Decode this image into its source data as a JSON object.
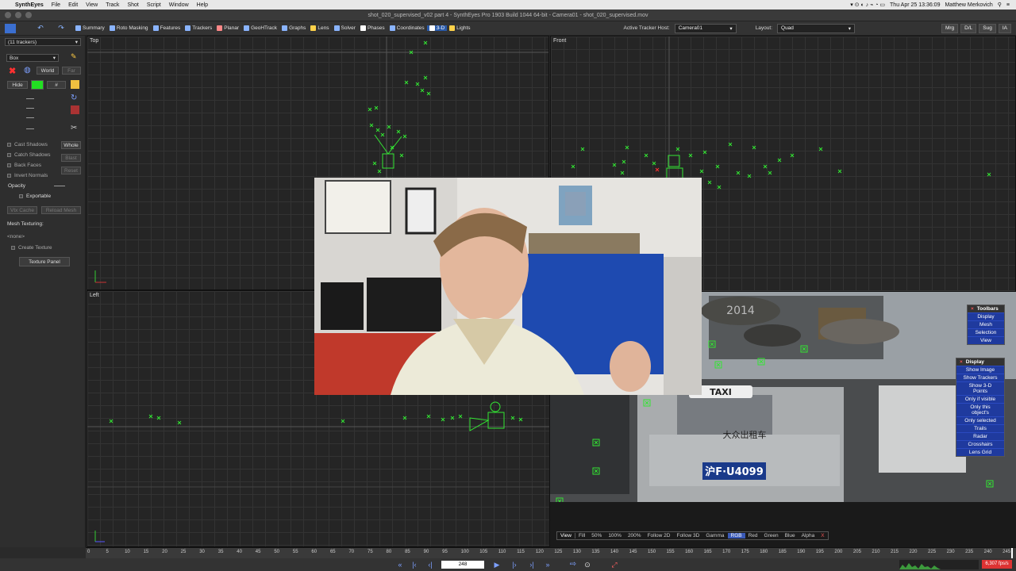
{
  "menubar": {
    "items": [
      "SynthEyes",
      "File",
      "Edit",
      "View",
      "Track",
      "Shot",
      "Script",
      "Window",
      "Help"
    ],
    "datetime": "Thu Apr 25  13:36:09",
    "user": "Matthew Merkovich"
  },
  "window": {
    "title": "shot_020_supervised_v02 part 4 - SynthEyes Pro 1903 Build 1044 64-bit - Camera01 - shot_020_supervised.mov"
  },
  "toolbar": {
    "tabs": [
      {
        "label": "Summary",
        "icon": "sigma-icon",
        "color": "#8ab4ff"
      },
      {
        "label": "Roto Masking",
        "icon": "roto-icon",
        "color": "#8ab4ff"
      },
      {
        "label": "Features",
        "icon": "features-icon",
        "color": "#8ab4ff"
      },
      {
        "label": "Trackers",
        "icon": "trackers-icon",
        "color": "#8ab4ff"
      },
      {
        "label": "Planar",
        "icon": "planar-icon",
        "color": "#ff8888"
      },
      {
        "label": "GeoHTrack",
        "icon": "geohtrack-icon",
        "color": "#8ab4ff"
      },
      {
        "label": "Graphs",
        "icon": "graphs-icon",
        "color": "#8ab4ff"
      },
      {
        "label": "Lens",
        "icon": "lens-icon",
        "color": "#ffd24a"
      },
      {
        "label": "Solver",
        "icon": "solver-icon",
        "color": "#8ab4ff"
      },
      {
        "label": "Phases",
        "icon": "phases-icon",
        "color": "#ffffff"
      },
      {
        "label": "Coordinates",
        "icon": "coordinates-icon",
        "color": "#8ab4ff"
      },
      {
        "label": "3-D",
        "icon": "cube-icon",
        "color": "#ffffff"
      },
      {
        "label": "Lights",
        "icon": "bulb-icon",
        "color": "#ffd24a"
      }
    ],
    "active_tab": "3-D",
    "active_tracker_host_label": "Active Tracker Host:",
    "active_tracker_host_value": "Camera01",
    "layout_label": "Layout:",
    "layout_value": "Quad",
    "right_buttons": [
      "Mrg",
      "D/L",
      "Sug",
      "IA"
    ]
  },
  "panel": {
    "tracker_select": "(11 trackers)",
    "shape_select": "Box",
    "world_btn": "World",
    "far_btn": "Far",
    "hide_btn": "Hide",
    "hash_btn": "#",
    "swatch_color": "#22e022",
    "cast_shadows": "Cast Shadows",
    "whole_btn": "Whole",
    "catch_shadows": "Catch Shadows",
    "blast_btn": "Blast",
    "back_faces": "Back Faces",
    "reset_btn": "Reset",
    "invert_normals": "Invert Normals",
    "opacity_label": "Opacity",
    "exportable": "Exportable",
    "vtx_cache_btn": "Vtx Cache",
    "reload_mesh_btn": "Reload Mesh",
    "mesh_texturing_label": "Mesh Texturing:",
    "texture_none": "<none>",
    "create_texture": "Create Texture",
    "texture_panel_btn": "Texture Panel"
  },
  "viewports": {
    "top": "Top",
    "front": "Front",
    "left": "Left"
  },
  "camera_view": {
    "toolbars_menu": {
      "title": "Toolbars",
      "items": [
        "Display",
        "Mesh",
        "Selection",
        "View"
      ]
    },
    "display_menu": {
      "title": "Display",
      "items": [
        "Show Image",
        "Show Trackers",
        "Show 3-D Points",
        "Only if visible",
        "Only this object's",
        "Only selected",
        "Trails",
        "Radar",
        "Crosshairs",
        "Lens Grid"
      ]
    },
    "plate_text": {
      "plate": "沪F·U4099",
      "sign": "2014",
      "taxi": "TAXI",
      "roof": "大众出租车"
    },
    "view_bar": [
      "View",
      "Fill",
      "50%",
      "100%",
      "200%",
      "Follow 2D",
      "Follow 3D",
      "Gamma",
      "RGB",
      "Red",
      "Green",
      "Blue",
      "Alpha",
      "X"
    ],
    "view_bar_on": "RGB"
  },
  "timeline": {
    "ticks": [
      "0",
      "5",
      "10",
      "15",
      "20",
      "25",
      "30",
      "35",
      "40",
      "45",
      "50",
      "55",
      "60",
      "65",
      "70",
      "75",
      "80",
      "85",
      "90",
      "95",
      "100",
      "105",
      "110",
      "115",
      "120",
      "125",
      "130",
      "135",
      "140",
      "145",
      "150",
      "155",
      "160",
      "165",
      "170",
      "175",
      "180",
      "185",
      "190",
      "195",
      "200",
      "205",
      "210",
      "215",
      "220",
      "225",
      "230",
      "235",
      "240",
      "245"
    ]
  },
  "playback": {
    "frame": "248",
    "fps": "6,307 fps/s",
    "buttons": [
      "first-frame",
      "prev-key",
      "prev-frame",
      "play",
      "next-frame",
      "next-key",
      "last-frame"
    ],
    "button_glyphs": [
      "«",
      "|‹",
      "‹|",
      "▶",
      "|›",
      "›|",
      "»"
    ]
  },
  "colors": {
    "tracker_green": "#33e633",
    "selected_red": "#ff3030",
    "menu_blue": "#1f3a9e",
    "active_tab_blue": "#2a5aa8"
  }
}
